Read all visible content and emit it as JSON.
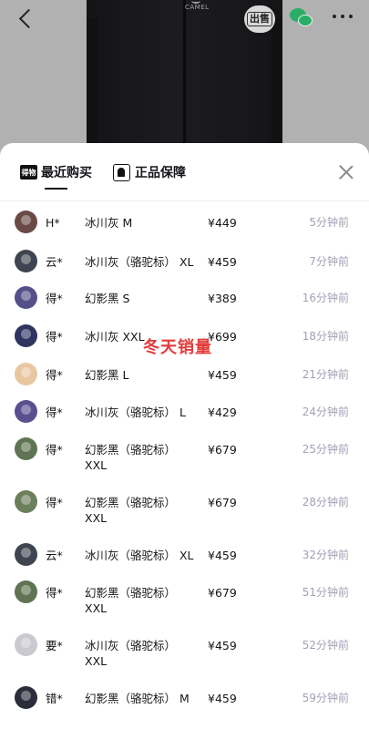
{
  "product": {
    "brand": "CAMEL"
  },
  "header": {
    "sell_label": "出售"
  },
  "tabs": [
    {
      "icon_text": "得物",
      "label": "最近购买"
    },
    {
      "label": "正品保障"
    }
  ],
  "watermark": "冬天销量",
  "purchases": [
    {
      "user": "H*",
      "spec": "冰川灰 M",
      "price": "¥449",
      "time": "5分钟前",
      "avatar_color": "#6b4a45"
    },
    {
      "user": "云*",
      "spec": "冰川灰（骆驼标） XL",
      "price": "¥459",
      "time": "7分钟前",
      "avatar_color": "#3f4550"
    },
    {
      "user": "得*",
      "spec": "幻影黑 S",
      "price": "¥389",
      "time": "16分钟前",
      "avatar_color": "#55508a"
    },
    {
      "user": "得*",
      "spec": "冰川灰 XXL",
      "price": "¥699",
      "time": "18分钟前",
      "avatar_color": "#2e3560"
    },
    {
      "user": "得*",
      "spec": "幻影黑 L",
      "price": "¥459",
      "time": "21分钟前",
      "avatar_color": "#e8c7a0"
    },
    {
      "user": "得*",
      "spec": "冰川灰（骆驼标） L",
      "price": "¥429",
      "time": "24分钟前",
      "avatar_color": "#5a4f8f"
    },
    {
      "user": "得*",
      "spec": "幻影黑（骆驼标）XXL",
      "price": "¥679",
      "time": "25分钟前",
      "avatar_color": "#5f7452"
    },
    {
      "user": "得*",
      "spec": "幻影黑（骆驼标）XXL",
      "price": "¥679",
      "time": "28分钟前",
      "avatar_color": "#6c7f5c"
    },
    {
      "user": "云*",
      "spec": "冰川灰（骆驼标） XL",
      "price": "¥459",
      "time": "32分钟前",
      "avatar_color": "#3f4550"
    },
    {
      "user": "得*",
      "spec": "幻影黑（骆驼标）XXL",
      "price": "¥679",
      "time": "51分钟前",
      "avatar_color": "#5f7452"
    },
    {
      "user": "要*",
      "spec": "冰川灰（骆驼标）XXL",
      "price": "¥459",
      "time": "52分钟前",
      "avatar_color": "#c9c9cf"
    },
    {
      "user": "错*",
      "spec": "幻影黑（骆驼标） M",
      "price": "¥459",
      "time": "59分钟前",
      "avatar_color": "#2b2d3a"
    }
  ]
}
